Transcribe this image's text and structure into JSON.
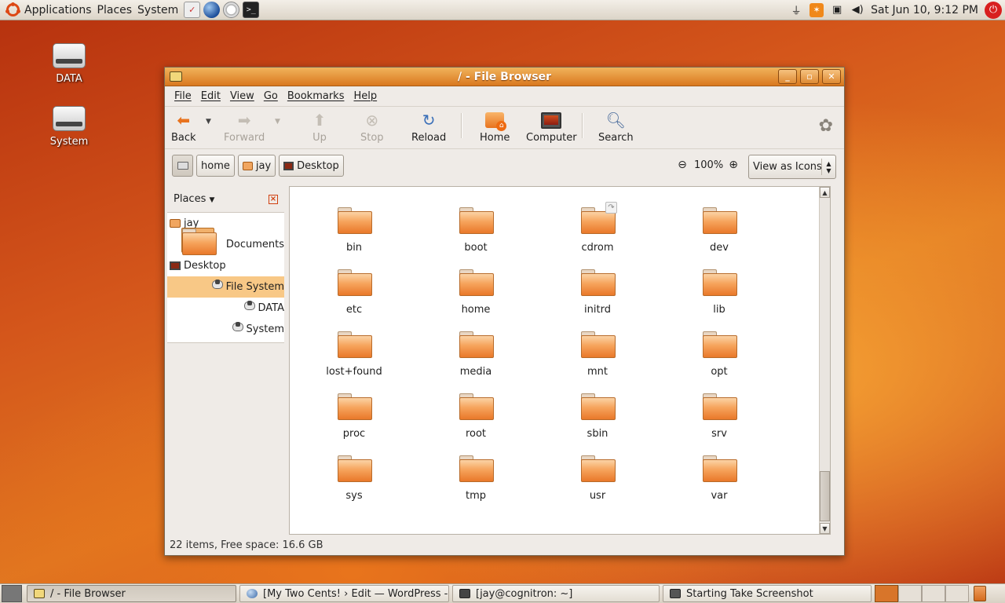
{
  "top_panel": {
    "menus": [
      "Applications",
      "Places",
      "System"
    ],
    "clock": "Sat Jun 10,  9:12 PM"
  },
  "desktop": {
    "icons": [
      {
        "label": "DATA"
      },
      {
        "label": "System"
      }
    ]
  },
  "window": {
    "title": "/ - File Browser",
    "menubar": [
      "File",
      "Edit",
      "View",
      "Go",
      "Bookmarks",
      "Help"
    ],
    "toolbar": {
      "back": "Back",
      "forward": "Forward",
      "up": "Up",
      "stop": "Stop",
      "reload": "Reload",
      "home": "Home",
      "computer": "Computer",
      "search": "Search"
    },
    "location": {
      "crumbs": [
        "home",
        "jay",
        "Desktop"
      ],
      "zoom": "100%",
      "view_mode": "View as Icons"
    },
    "sidebar": {
      "header": "Places",
      "items": [
        {
          "label": "jay",
          "icon": "home-folder-icon"
        },
        {
          "label": "Documents",
          "icon": "folder-icon"
        },
        {
          "label": "Desktop",
          "icon": "desktop-icon"
        },
        {
          "label": "File System",
          "icon": "drive-icon",
          "selected": true
        },
        {
          "label": "DATA",
          "icon": "drive-icon"
        },
        {
          "label": "System",
          "icon": "drive-icon"
        }
      ]
    },
    "files": [
      "bin",
      "boot",
      "cdrom",
      "dev",
      "etc",
      "home",
      "initrd",
      "lib",
      "lost+found",
      "media",
      "mnt",
      "opt",
      "proc",
      "root",
      "sbin",
      "srv",
      "sys",
      "tmp",
      "usr",
      "var"
    ],
    "status": "22 items, Free space: 16.6 GB"
  },
  "taskbar": {
    "tasks": [
      {
        "label": "/ - File Browser",
        "active": true
      },
      {
        "label": "[My Two Cents! › Edit — WordPress - ..."
      },
      {
        "label": "[jay@cognitron: ~]"
      },
      {
        "label": "Starting Take Screenshot"
      }
    ]
  },
  "colors": {
    "accent": "#dd4814",
    "titlebar": "#e38b32",
    "selection": "#f8c886"
  }
}
